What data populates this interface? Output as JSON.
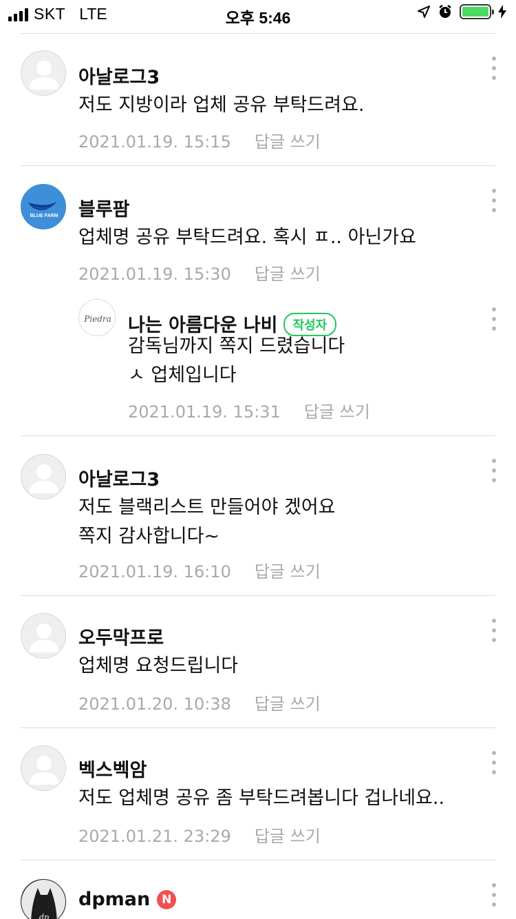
{
  "status_bar": {
    "carrier": "SKT",
    "network": "LTE",
    "time": "오후 5:46",
    "battery_level": 1.0,
    "battery_color": "#4cd964"
  },
  "comments": [
    {
      "author": "아날로그3",
      "lines": [
        "저도 지방이라 업체 공유 부탁드려요."
      ],
      "date": "2021.01.19. 15:15",
      "reply_label": "답글 쓰기"
    },
    {
      "author": "블루팜",
      "avatar_text": "BLUE FARM",
      "lines": [
        "업체명 공유 부탁드려요. 혹시 ㅍ.. 아닌가요"
      ],
      "date": "2021.01.19. 15:30",
      "reply_label": "답글 쓰기"
    },
    {
      "author": "나는 아름다운 나비",
      "badge": "작성자",
      "avatar_text": "Piedra",
      "lines": [
        "감독님까지 쪽지 드렸습니다",
        "ㅅ 업체입니다"
      ],
      "date": "2021.01.19. 15:31",
      "reply_label": "답글 쓰기"
    },
    {
      "author": "아날로그3",
      "lines": [
        "저도 블랙리스트 만들어야 겠어요",
        "쪽지 감사합니다~"
      ],
      "date": "2021.01.19. 16:10",
      "reply_label": "답글 쓰기"
    },
    {
      "author": "오두막프로",
      "lines": [
        "업체명 요청드립니다"
      ],
      "date": "2021.01.20. 10:38",
      "reply_label": "답글 쓰기"
    },
    {
      "author": "벡스벡암",
      "lines": [
        "저도 업체명 공유 좀 부탁드려봅니다 겁나네요.."
      ],
      "date": "2021.01.21. 23:29",
      "reply_label": "답글 쓰기"
    },
    {
      "author": "dpman",
      "badge": "N",
      "avatar_text": "dp"
    }
  ],
  "colors": {
    "author_badge": "#1fc75c",
    "new_badge": "#f25050",
    "meta_text": "#a9a9a9",
    "divider": "#dcdcdc"
  }
}
